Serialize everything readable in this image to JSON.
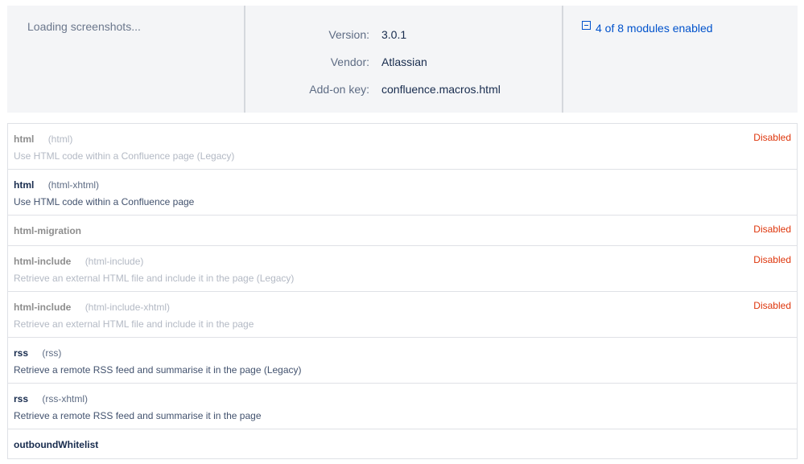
{
  "summary": {
    "screenshots_status": "Loading screenshots...",
    "meta": [
      {
        "label": "Version:",
        "value": "3.0.1"
      },
      {
        "label": "Vendor:",
        "value": "Atlassian"
      },
      {
        "label": "Add-on key:",
        "value": "confluence.macros.html"
      }
    ],
    "modules_toggle": "4 of 8 modules enabled"
  },
  "modules": [
    {
      "name": "html",
      "key": "(html)",
      "description": "Use HTML code within a Confluence page (Legacy)",
      "status": "Disabled"
    },
    {
      "name": "html",
      "key": "(html-xhtml)",
      "description": "Use HTML code within a Confluence page",
      "status": ""
    },
    {
      "name": "html-migration",
      "key": "",
      "description": "",
      "status": "Disabled"
    },
    {
      "name": "html-include",
      "key": "(html-include)",
      "description": "Retrieve an external HTML file and include it in the page (Legacy)",
      "status": "Disabled"
    },
    {
      "name": "html-include",
      "key": "(html-include-xhtml)",
      "description": "Retrieve an external HTML file and include it in the page",
      "status": "Disabled"
    },
    {
      "name": "rss",
      "key": "(rss)",
      "description": "Retrieve a remote RSS feed and summarise it in the page (Legacy)",
      "status": ""
    },
    {
      "name": "rss",
      "key": "(rss-xhtml)",
      "description": "Retrieve a remote RSS feed and summarise it in the page",
      "status": ""
    },
    {
      "name": "outboundWhitelist",
      "key": "",
      "description": "",
      "status": ""
    }
  ],
  "colors": {
    "link": "#0052cc",
    "disabled_status": "#de350b",
    "panel_bg": "#f4f5f7"
  }
}
